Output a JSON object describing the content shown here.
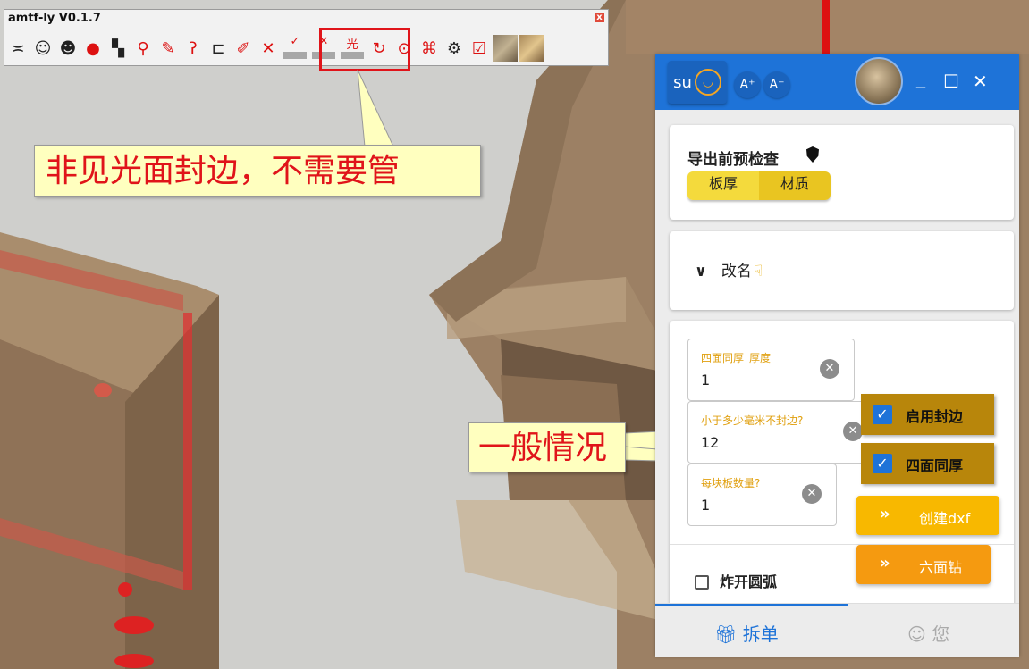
{
  "toolbar": {
    "title": "amtf-ly V0.1.7",
    "close": "x",
    "edge_icons": [
      "✓",
      "✕",
      "光"
    ]
  },
  "callouts": {
    "non_visible": "非见光面封边，不需要管",
    "general": "一般情况"
  },
  "panel": {
    "header": {
      "su_label": "su",
      "font_increase": "A⁺",
      "font_decrease": "A⁻",
      "minimize": "_",
      "maximize": "☐",
      "close": "✕"
    },
    "precheck": {
      "title": "导出前预检查",
      "buttons": [
        "板厚",
        "材质"
      ]
    },
    "rename": {
      "label": "改名"
    },
    "fields": [
      {
        "label": "四面同厚_厚度",
        "value": "1"
      },
      {
        "label": "小于多少毫米不封边?",
        "value": "12"
      },
      {
        "label": "每块板数量?",
        "value": "1"
      }
    ],
    "options": {
      "enable_edge": "启用封边",
      "four_same": "四面同厚"
    },
    "actions": {
      "create_dxf": "创建dxf",
      "six_drill": "六面钻"
    },
    "burst_arc": "炸开圆弧",
    "tabs": {
      "split": "拆单",
      "you": "您"
    }
  },
  "colors": {
    "accent": "#1e73d8",
    "highlight": "#e0141a",
    "callout_bg": "#ffffbf",
    "gold": "#b8860b",
    "orange": "#f8b800"
  }
}
